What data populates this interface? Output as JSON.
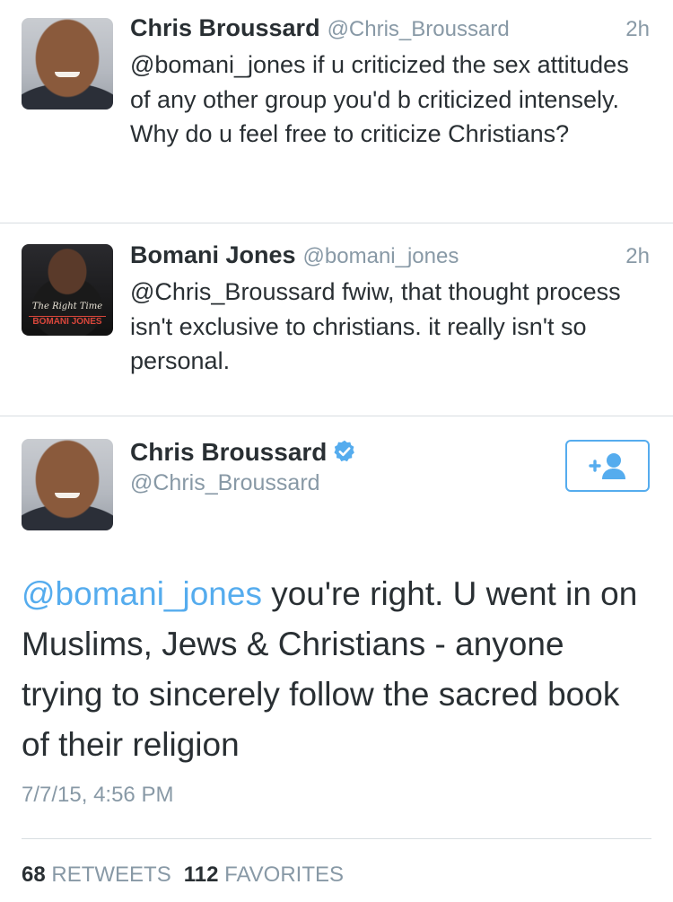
{
  "tweets": [
    {
      "name": "Chris Broussard",
      "handle": "@Chris_Broussard",
      "time": "2h",
      "text": "@bomani_jones if u criticized the sex attitudes of any other group you'd b criticized intensely. Why do u feel free to criticize Christians?"
    },
    {
      "name": "Bomani Jones",
      "handle": "@bomani_jones",
      "time": "2h",
      "text": "@Chris_Broussard fwiw, that thought process isn't exclusive to christians. it really isn't so personal.",
      "avatar_text": {
        "script": "The Right Time",
        "name": "BOMANI JONES"
      }
    }
  ],
  "main_tweet": {
    "name": "Chris Broussard",
    "handle": "@Chris_Broussard",
    "verified_icon": "verified-badge-icon",
    "follow_icon": "add-user-icon",
    "mention": "@bomani_jones",
    "text": " you're right. U went in on Muslims, Jews & Christians - anyone trying to sincerely follow the sacred book of their religion",
    "timestamp": "7/7/15, 4:56 PM",
    "retweets_count": "68",
    "retweets_label": "RETWEETS",
    "favorites_count": "112",
    "favorites_label": "FAVORITES"
  },
  "colors": {
    "accent": "#55acee",
    "text": "#292f33",
    "muted": "#8899a6",
    "divider": "#d8dde1"
  }
}
